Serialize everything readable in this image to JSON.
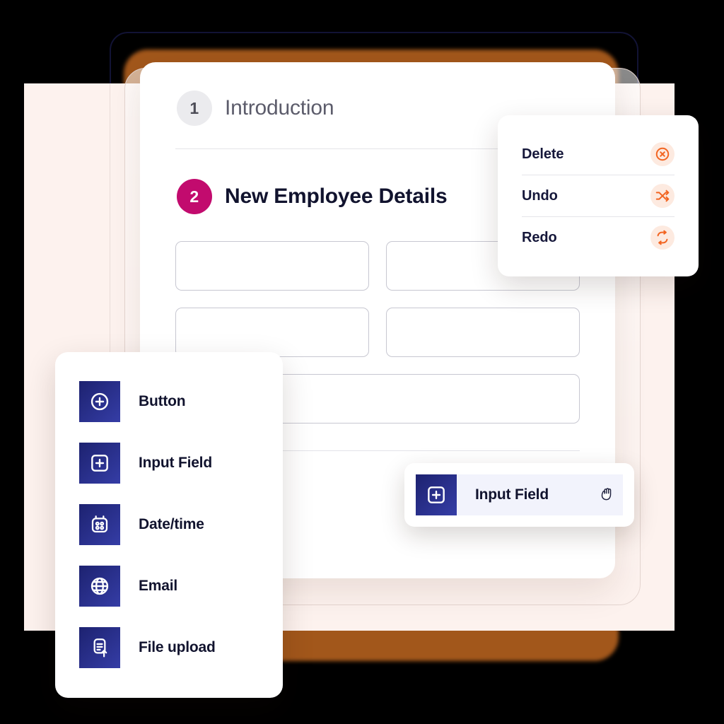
{
  "form_card": {
    "steps": [
      {
        "number": "1",
        "title": "Introduction",
        "state": "inactive"
      },
      {
        "number": "2",
        "title": "New Employee Details",
        "state": "active"
      }
    ],
    "fields": [
      {
        "name": "field-1",
        "value": "",
        "placeholder": ""
      },
      {
        "name": "field-2",
        "value": "",
        "placeholder": ""
      },
      {
        "name": "field-3",
        "value": "",
        "placeholder": ""
      },
      {
        "name": "field-4",
        "value": "",
        "placeholder": ""
      },
      {
        "name": "field-5-wide",
        "value": "",
        "placeholder": ""
      }
    ]
  },
  "context_menu": {
    "items": [
      {
        "label": "Delete",
        "icon": "circle-x-icon"
      },
      {
        "label": "Undo",
        "icon": "shuffle-arrows-icon"
      },
      {
        "label": "Redo",
        "icon": "repeat-loop-icon"
      }
    ]
  },
  "palette": {
    "items": [
      {
        "label": "Button",
        "icon": "circle-plus-icon"
      },
      {
        "label": "Input Field",
        "icon": "square-plus-icon"
      },
      {
        "label": "Date/time",
        "icon": "calendar-icon"
      },
      {
        "label": "Email",
        "icon": "globe-icon"
      },
      {
        "label": "File upload",
        "icon": "document-upload-icon"
      }
    ]
  },
  "drag_chip": {
    "label": "Input Field",
    "icon": "square-plus-icon",
    "cursor": "grabbing-hand-cursor"
  },
  "colors": {
    "accent_magenta": "#C20B6E",
    "accent_orange": "#F26522",
    "tile_navy": "#1D2270",
    "background_pink": "#FDF2EE",
    "shadow_brown": "#A2571B",
    "outline_navy": "#121335",
    "text_dark": "#11132E",
    "chip_tint": "#F2F3FC"
  }
}
